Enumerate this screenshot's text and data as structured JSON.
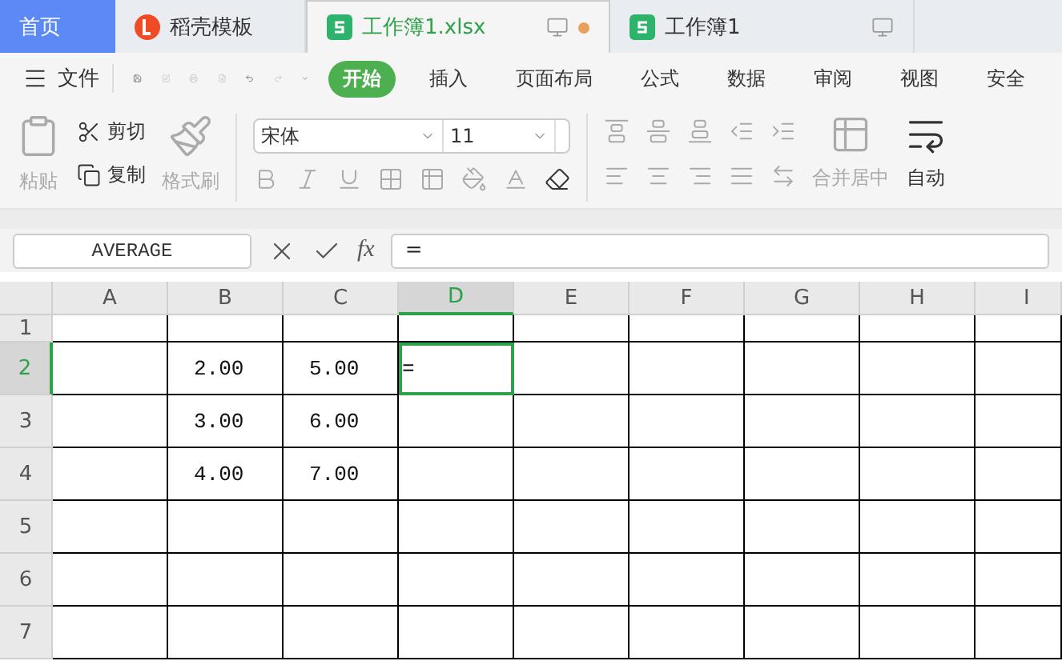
{
  "tabs": [
    {
      "kind": "home",
      "label": "首页",
      "selected": false,
      "unsaved": false
    },
    {
      "kind": "docer",
      "label": "稻壳模板",
      "selected": false,
      "unsaved": false
    },
    {
      "kind": "sheet",
      "label": "工作簿1.xlsx",
      "selected": true,
      "unsaved": true
    },
    {
      "kind": "sheet",
      "label": "工作簿1",
      "selected": false,
      "unsaved": false
    }
  ],
  "file_menu": "文件",
  "ribbon_tabs": [
    {
      "label": "开始",
      "selected": true
    },
    {
      "label": "插入",
      "selected": false
    },
    {
      "label": "页面布局",
      "selected": false
    },
    {
      "label": "公式",
      "selected": false
    },
    {
      "label": "数据",
      "selected": false
    },
    {
      "label": "审阅",
      "selected": false
    },
    {
      "label": "视图",
      "selected": false
    },
    {
      "label": "安全",
      "selected": false
    }
  ],
  "clipboard": {
    "paste": {
      "label": "粘贴",
      "disabled": true
    },
    "cut": {
      "label": "剪切",
      "disabled": false
    },
    "copy": {
      "label": "复制",
      "disabled": false
    },
    "format_painter": {
      "label": "格式刷",
      "disabled": true
    }
  },
  "font": {
    "name": "宋体",
    "size": "11"
  },
  "merge_label": "合并居中",
  "wrap_label": "自动",
  "formula_bar": {
    "name_box": "AVERAGE",
    "fx": "fx",
    "formula": "="
  },
  "columns": [
    {
      "label": "A",
      "selected": false
    },
    {
      "label": "B",
      "selected": false
    },
    {
      "label": "C",
      "selected": false
    },
    {
      "label": "D",
      "selected": true
    },
    {
      "label": "E",
      "selected": false
    },
    {
      "label": "F",
      "selected": false
    },
    {
      "label": "G",
      "selected": false
    },
    {
      "label": "H",
      "selected": false
    },
    {
      "label": "I",
      "selected": false
    }
  ],
  "rows": [
    {
      "header": "1",
      "selected": false,
      "cells": []
    },
    {
      "header": "2",
      "selected": true,
      "cells": [
        null,
        {
          "text": "2.00",
          "selected": false
        },
        {
          "text": "5.00",
          "selected": false
        },
        {
          "text": "=",
          "selected": true
        }
      ]
    },
    {
      "header": "3",
      "selected": false,
      "cells": [
        null,
        {
          "text": "3.00",
          "selected": false
        },
        {
          "text": "6.00",
          "selected": false
        }
      ]
    },
    {
      "header": "4",
      "selected": false,
      "cells": [
        null,
        {
          "text": "4.00",
          "selected": false
        },
        {
          "text": "7.00",
          "selected": false
        }
      ]
    },
    {
      "header": "5",
      "selected": false,
      "cells": []
    },
    {
      "header": "6",
      "selected": false,
      "cells": []
    },
    {
      "header": "7",
      "selected": false,
      "cells": []
    }
  ]
}
